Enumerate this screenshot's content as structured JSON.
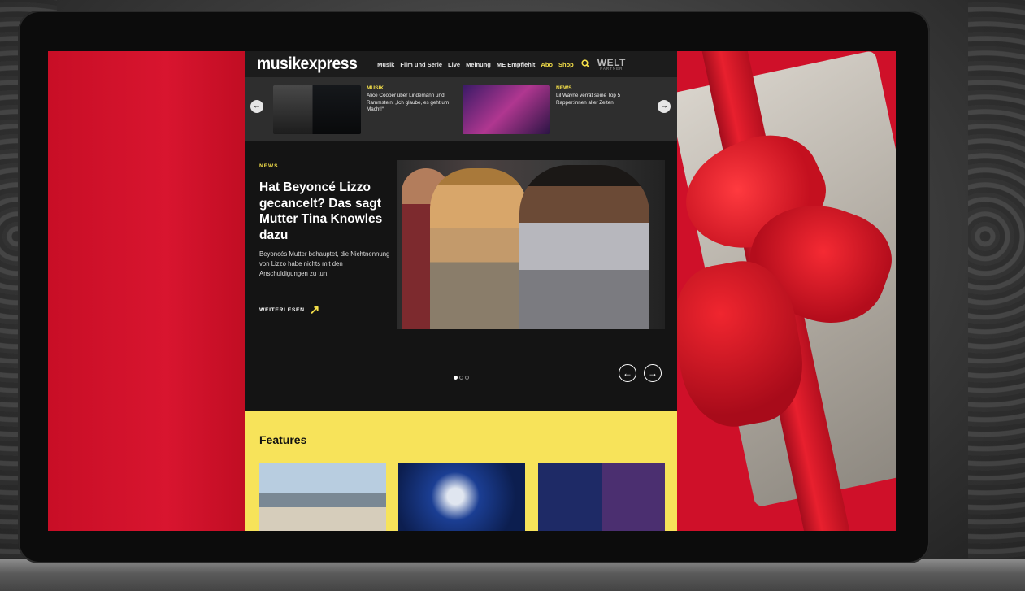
{
  "site": {
    "logo": "musikexpress",
    "nav": [
      "Musik",
      "Film und Serie",
      "Live",
      "Meinung",
      "ME Empfiehlt",
      "Abo",
      "Shop"
    ],
    "partner": {
      "name": "WELT",
      "label": "PARTNER"
    }
  },
  "ticker": {
    "items": [
      {
        "category": "MUSIK",
        "title": "Alice Cooper über Lindemann und Rammstein: „Ich glaube, es geht um Macht!“"
      },
      {
        "category": "NEWS",
        "title": "Lil Wayne verrät seine Top 5 Rapper:innen aller Zeiten"
      }
    ],
    "prev_icon": "←",
    "next_icon": "→"
  },
  "hero": {
    "category": "NEWS",
    "title": "Hat Beyoncé Lizzo gecancelt? Das sagt Mutter Tina Knowles dazu",
    "description": "Beyoncés Mutter behauptet, die Nichtnennung von Lizzo habe nichts mit den Anschuldigungen zu tun.",
    "more": "WEITERLESEN",
    "more_icon": "↗",
    "prev_icon": "←",
    "next_icon": "→",
    "slide_count": 3,
    "active_slide": 1
  },
  "features": {
    "title": "Features"
  },
  "colors": {
    "accent": "#f5e04a",
    "background_red": "#d0112b",
    "site_dark": "#111111"
  }
}
